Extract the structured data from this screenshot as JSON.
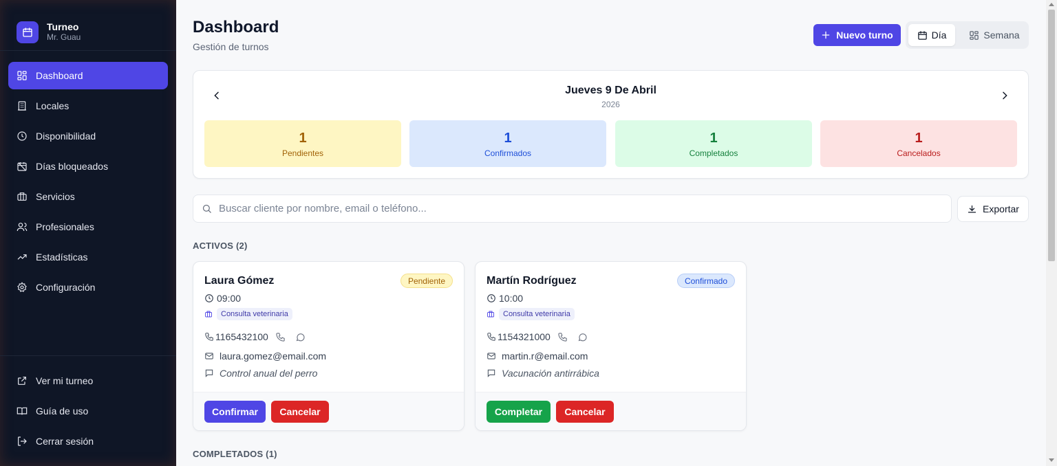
{
  "brand": {
    "title": "Turneo",
    "subtitle": "Mr. Guau"
  },
  "sidebar": {
    "items": [
      {
        "label": "Dashboard",
        "icon": "layout-grid-icon"
      },
      {
        "label": "Locales",
        "icon": "building-icon"
      },
      {
        "label": "Disponibilidad",
        "icon": "clock-icon"
      },
      {
        "label": "Días bloqueados",
        "icon": "calendar-off-icon"
      },
      {
        "label": "Servicios",
        "icon": "briefcase-icon"
      },
      {
        "label": "Profesionales",
        "icon": "users-icon"
      },
      {
        "label": "Estadísticas",
        "icon": "trending-up-icon"
      },
      {
        "label": "Configuración",
        "icon": "gear-icon"
      }
    ],
    "footer": [
      {
        "label": "Ver mi turneo",
        "icon": "external-link-icon"
      },
      {
        "label": "Guía de uso",
        "icon": "book-icon"
      },
      {
        "label": "Cerrar sesión",
        "icon": "logout-icon"
      }
    ]
  },
  "header": {
    "title": "Dashboard",
    "subtitle": "Gestión de turnos",
    "new_button": "Nuevo turno",
    "view_day": "Día",
    "view_week": "Semana"
  },
  "date": {
    "title": "Jueves 9 De Abril",
    "year": "2026"
  },
  "stats": [
    {
      "value": "1",
      "label": "Pendientes",
      "bg": "#fef6c3",
      "fg": "#a16207"
    },
    {
      "value": "1",
      "label": "Confirmados",
      "bg": "#dbe8fd",
      "fg": "#1d4ed8"
    },
    {
      "value": "1",
      "label": "Completados",
      "bg": "#dcfce7",
      "fg": "#15803d"
    },
    {
      "value": "1",
      "label": "Cancelados",
      "bg": "#fde2e2",
      "fg": "#b91c1c"
    }
  ],
  "search": {
    "placeholder": "Buscar cliente por nombre, email o teléfono..."
  },
  "export_label": "Exportar",
  "sections": {
    "active": "ACTIVOS (2)",
    "completed": "COMPLETADOS (1)"
  },
  "appointments": [
    {
      "name": "Laura Gómez",
      "status": "Pendiente",
      "status_bg": "#fef6c3",
      "status_fg": "#a16207",
      "status_border": "#f5e08a",
      "time": "09:00",
      "service": "Consulta veterinaria",
      "phone": "1165432100",
      "email": "laura.gomez@email.com",
      "note": "Control anual del perro",
      "primary_action": "Confirmar",
      "primary_color": "#4f46e5",
      "secondary_action": "Cancelar"
    },
    {
      "name": "Martín Rodríguez",
      "status": "Confirmado",
      "status_bg": "#dbe8fd",
      "status_fg": "#1d4ed8",
      "status_border": "#b7cdf7",
      "time": "10:00",
      "service": "Consulta veterinaria",
      "phone": "1154321000",
      "email": "martin.r@email.com",
      "note": "Vacunación antirrábica",
      "primary_action": "Completar",
      "primary_color": "#16a34a",
      "secondary_action": "Cancelar"
    }
  ],
  "colors": {
    "accent": "#4f46e5",
    "danger": "#dc2626",
    "sidebar_bg": "#0f1626"
  }
}
